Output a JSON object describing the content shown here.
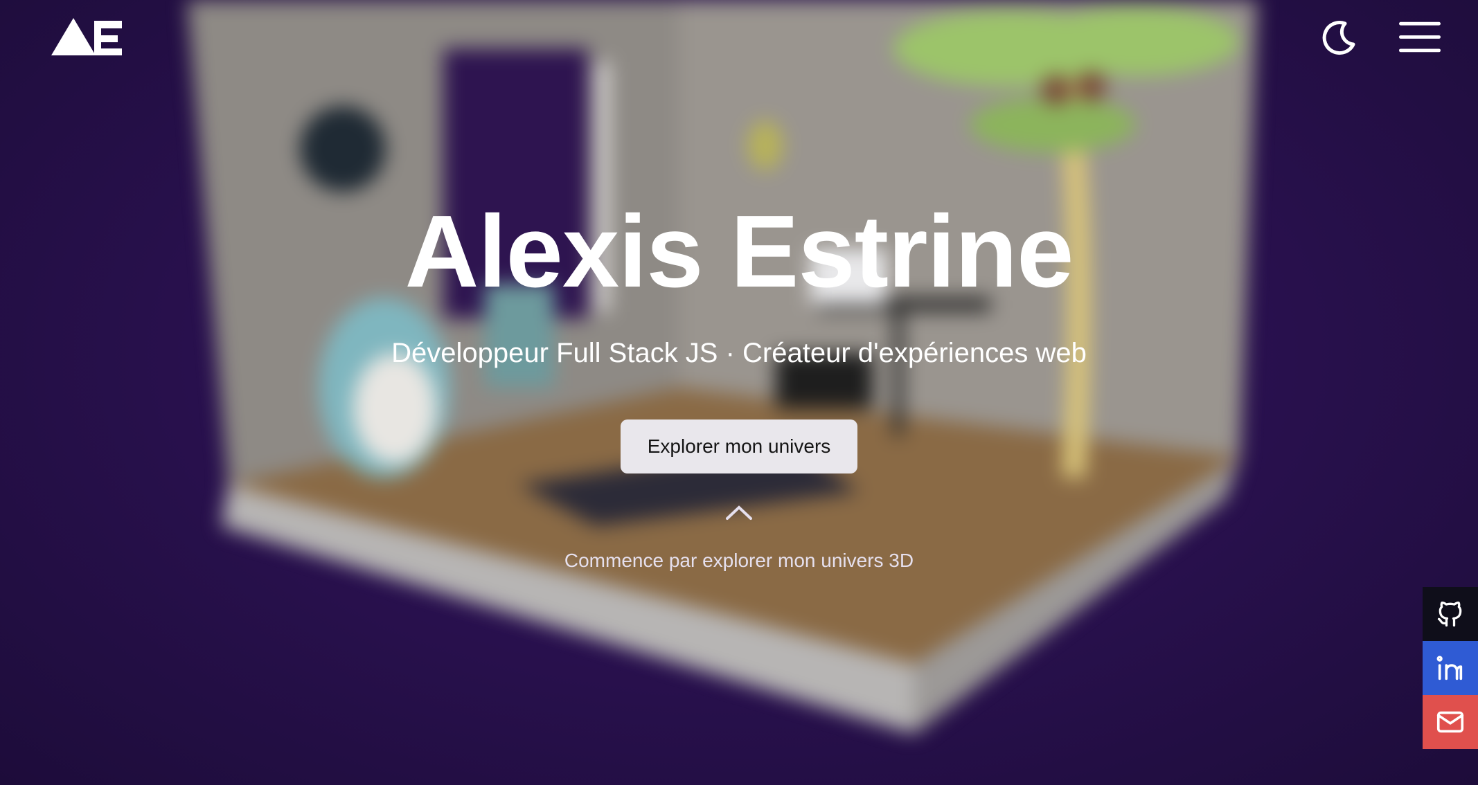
{
  "colors": {
    "background_center": "#3a1764",
    "background_edge": "#1d0c3a",
    "github": "#0f0e1a",
    "linkedin": "#2f5bd4",
    "email": "#e0504d",
    "cta_background": "#e9e7ec"
  },
  "header": {
    "logo_icon": "ae-logo-icon",
    "theme_toggle_icon": "moon-icon",
    "menu_icon": "hamburger-menu-icon"
  },
  "hero": {
    "title": "Alexis Estrine",
    "subtitle": "Développeur Full Stack JS · Créateur d'expériences web",
    "cta_label": "Explorer mon univers",
    "chevron_icon": "chevron-up-icon",
    "hint": "Commence par explorer mon univers 3D"
  },
  "social": {
    "items": [
      {
        "name": "github",
        "icon": "github-icon"
      },
      {
        "name": "linkedin",
        "icon": "linkedin-icon"
      },
      {
        "name": "email",
        "icon": "mail-icon"
      }
    ]
  }
}
